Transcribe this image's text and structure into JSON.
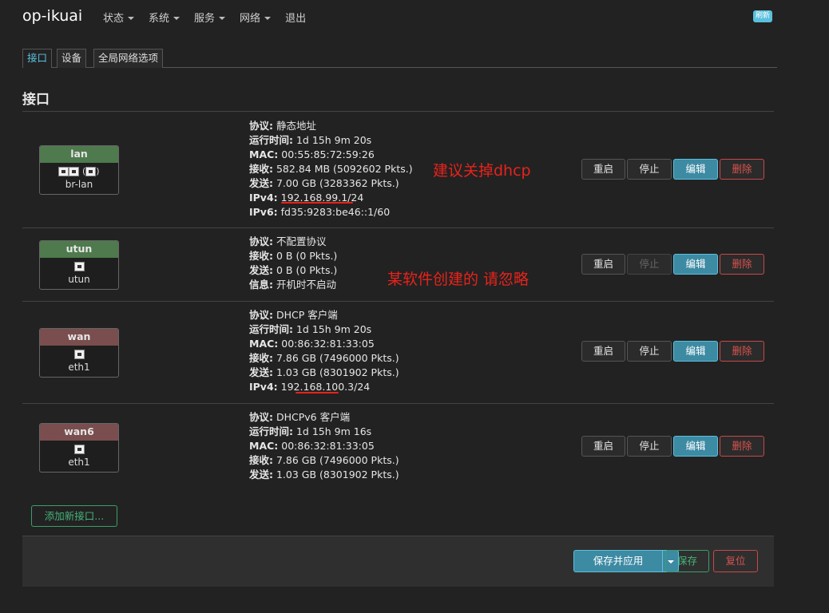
{
  "brand": "op-ikuai",
  "nav": [
    {
      "label": "状态"
    },
    {
      "label": "系统"
    },
    {
      "label": "服务"
    },
    {
      "label": "网络"
    },
    {
      "label": "退出",
      "no_caret": true
    }
  ],
  "refresh_label": "刷新",
  "tabs": [
    "接口",
    "设备",
    "全局网络选项"
  ],
  "page_title": "接口",
  "buttons": {
    "restart": "重启",
    "stop": "停止",
    "edit": "编辑",
    "delete": "删除"
  },
  "interfaces": [
    {
      "name": "lan",
      "device": "br-lan",
      "color": "#4e7a4e",
      "lines": [
        {
          "k": "协议:",
          "v": "静态地址"
        },
        {
          "k": "运行时间:",
          "v": "1d 15h 9m 20s"
        },
        {
          "k": "MAC:",
          "v": "00:55:85:72:59:26"
        },
        {
          "k": "接收:",
          "v": "582.84 MB (5092602 Pkts.)"
        },
        {
          "k": "发送:",
          "v": "7.00 GB (3283362 Pkts.)"
        },
        {
          "k": "IPv4:",
          "v": "192.168.99.1/24"
        },
        {
          "k": "IPv6:",
          "v": "fd35:9283:be46::1/60"
        }
      ],
      "stop_disabled": false
    },
    {
      "name": "utun",
      "device": "utun",
      "color": "#4e7a4e",
      "lines": [
        {
          "k": "协议:",
          "v": "不配置协议"
        },
        {
          "k": "接收:",
          "v": "0 B (0 Pkts.)"
        },
        {
          "k": "发送:",
          "v": "0 B (0 Pkts.)"
        },
        {
          "k": "信息:",
          "v": "开机时不启动"
        }
      ],
      "stop_disabled": true
    },
    {
      "name": "wan",
      "device": "eth1",
      "color": "#7a4e4e",
      "lines": [
        {
          "k": "协议:",
          "v": "DHCP 客户端"
        },
        {
          "k": "运行时间:",
          "v": "1d 15h 9m 20s"
        },
        {
          "k": "MAC:",
          "v": "00:86:32:81:33:05"
        },
        {
          "k": "接收:",
          "v": "7.86 GB (7496000 Pkts.)"
        },
        {
          "k": "发送:",
          "v": "1.03 GB (8301902 Pkts.)"
        },
        {
          "k": "IPv4:",
          "v": "192.168.100.3/24"
        }
      ],
      "stop_disabled": false
    },
    {
      "name": "wan6",
      "device": "eth1",
      "color": "#7a4e4e",
      "lines": [
        {
          "k": "协议:",
          "v": "DHCPv6 客户端"
        },
        {
          "k": "运行时间:",
          "v": "1d 15h 9m 16s"
        },
        {
          "k": "MAC:",
          "v": "00:86:32:81:33:05"
        },
        {
          "k": "接收:",
          "v": "7.86 GB (7496000 Pkts.)"
        },
        {
          "k": "发送:",
          "v": "1.03 GB (8301902 Pkts.)"
        }
      ],
      "stop_disabled": false
    }
  ],
  "annotations": [
    "建议关掉dhcp",
    "某软件创建的 请忽略"
  ],
  "add_interface": "添加新接口...",
  "footer": {
    "save_apply": "保存并应用",
    "save": "保存",
    "reset": "复位"
  }
}
